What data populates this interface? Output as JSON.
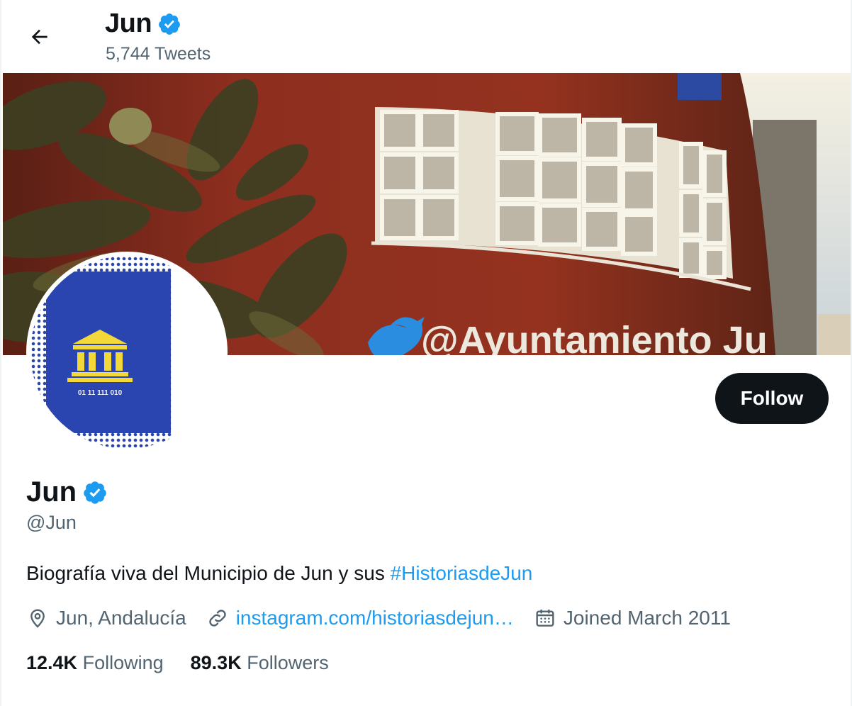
{
  "header": {
    "name": "Jun",
    "tweets_count": "5,744 Tweets"
  },
  "banner": {
    "sign_text": "@Ayuntamiento Ju"
  },
  "avatar": {
    "code_text": "01 11 111 010"
  },
  "profile": {
    "follow_label": "Follow",
    "name": "Jun",
    "handle": "@Jun",
    "bio_text": "Biografía viva del Municipio de Jun y sus ",
    "bio_hashtag": "#HistoriasdeJun",
    "location": "Jun, Andalucía",
    "website": "instagram.com/historiasdejun…",
    "joined": "Joined March 2011",
    "following_count": "12.4K",
    "following_label": "Following",
    "followers_count": "89.3K",
    "followers_label": "Followers"
  },
  "icons": {
    "back": "arrow-left-icon",
    "verified": "verified-badge-icon",
    "location": "location-pin-icon",
    "link": "link-icon",
    "calendar": "calendar-icon"
  },
  "colors": {
    "accent": "#1d9bf0",
    "text_primary": "#0f1419",
    "text_secondary": "#536471",
    "button_bg": "#0f1419",
    "avatar_blue": "#2a44b0",
    "avatar_yellow": "#f3d83a"
  }
}
